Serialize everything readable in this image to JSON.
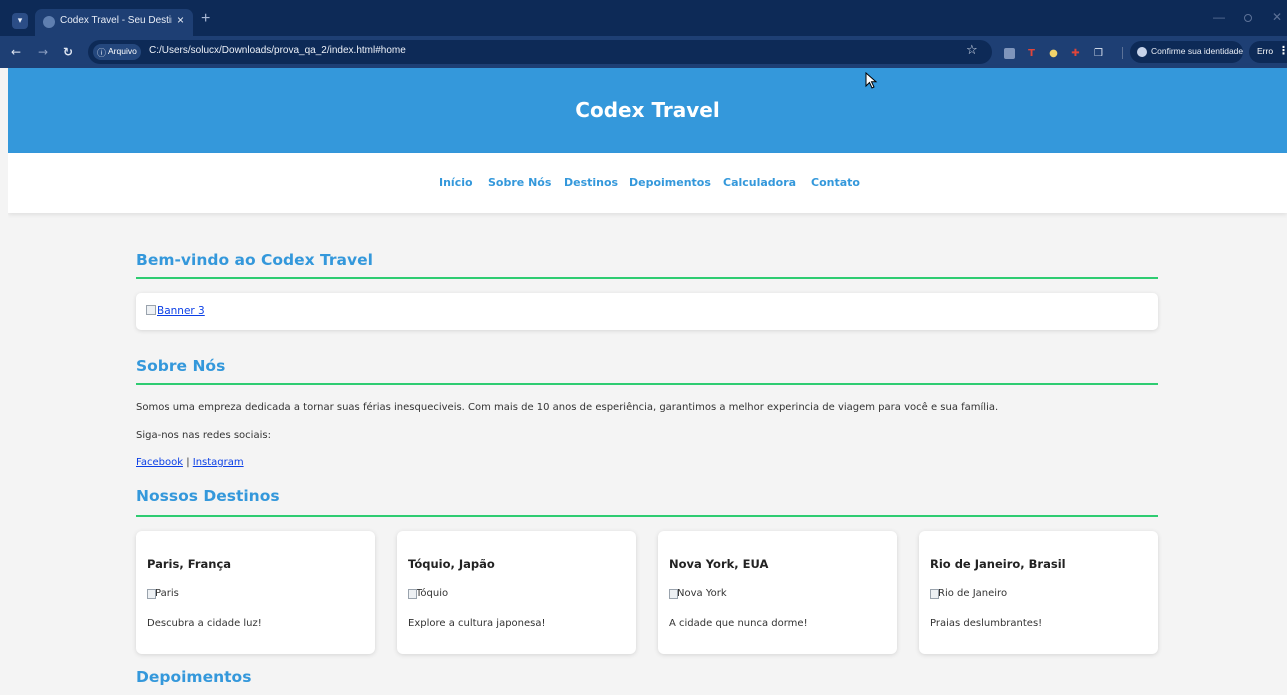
{
  "browser": {
    "tab_title": "Codex Travel - Seu Destino de",
    "tab_close": "×",
    "new_tab": "+",
    "security_chip": "Arquivo",
    "url": "C:/Users/solucx/Downloads/prova_qa_2/index.html#home",
    "profile_label": "Confirme sua identidade",
    "error_label": "Erro"
  },
  "site": {
    "title": "Codex Travel",
    "nav": [
      "Início",
      "Sobre Nós",
      "Destinos",
      "Depoimentos",
      "Calculadora",
      "Contato"
    ]
  },
  "welcome": {
    "title": "Bem-vindo ao Codex Travel",
    "banner_alt": "Banner 3"
  },
  "about": {
    "title": "Sobre Nós",
    "paragraph": "Somos uma empreza dedicada a tornar suas férias inesqueciveis. Com mais de 10 anos de esperiência, garantimos a melhor experincia de viagem para você e sua família.",
    "social_prompt": "Siga-nos nas redes sociais:",
    "facebook": "Facebook",
    "separator": "|",
    "instagram": "Instagram"
  },
  "destinations": {
    "title": "Nossos Destinos",
    "cards": [
      {
        "title": "Paris, França",
        "img_alt": "Paris",
        "desc": "Descubra a cidade luz!"
      },
      {
        "title": "Tóquio, Japão",
        "img_alt": "Tóquio",
        "desc": "Explore a cultura japonesa!"
      },
      {
        "title": "Nova York, EUA",
        "img_alt": "Nova York",
        "desc": "A cidade que nunca dorme!"
      },
      {
        "title": "Rio de Janeiro, Brasil",
        "img_alt": "Rio de Janeiro",
        "desc": "Praias deslumbrantes!"
      }
    ]
  },
  "testimonials": {
    "title": "Depoimentos"
  },
  "colors": {
    "header": "#3498db",
    "accent_line": "#2ecc71",
    "link": "#0b3fe6",
    "browser_frame": "#0d2a57"
  }
}
